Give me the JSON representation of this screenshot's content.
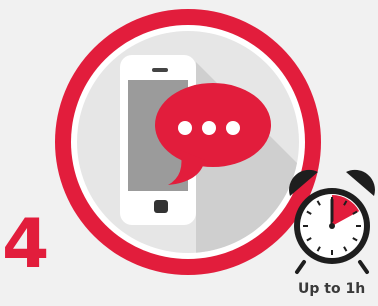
{
  "step": {
    "number": "4"
  },
  "timer": {
    "caption": "Up to 1h",
    "fraction_elapsed": 0.17
  },
  "icons": {
    "main": "smartphone-message-icon",
    "bubble": "chat-bubble-icon",
    "clock": "alarm-clock-icon"
  },
  "colors": {
    "accent": "#e21d3c",
    "background": "#f1f1f1",
    "text": "#3a3a3a"
  }
}
